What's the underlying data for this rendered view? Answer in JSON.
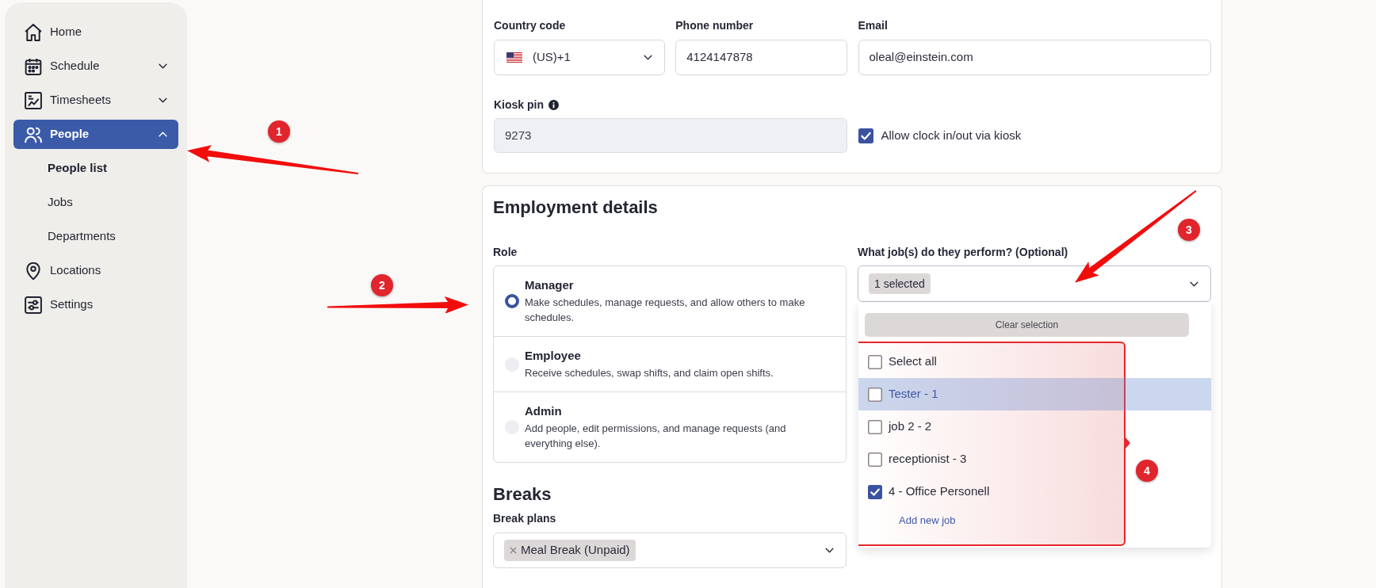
{
  "sidebar": {
    "items": [
      {
        "label": "Home",
        "kind": "link",
        "selected": false
      },
      {
        "label": "Schedule",
        "kind": "group",
        "selected": false,
        "expanded": false
      },
      {
        "label": "Timesheets",
        "kind": "group",
        "selected": false,
        "expanded": false
      },
      {
        "label": "People",
        "kind": "group",
        "selected": true,
        "expanded": true,
        "children": [
          {
            "label": "People list",
            "selected": true
          },
          {
            "label": "Jobs",
            "selected": false
          },
          {
            "label": "Departments",
            "selected": false
          }
        ]
      },
      {
        "label": "Locations",
        "kind": "link",
        "selected": false
      },
      {
        "label": "Settings",
        "kind": "link",
        "selected": false
      }
    ]
  },
  "contact": {
    "country_code": {
      "label": "Country code",
      "value": "(US)+1"
    },
    "phone": {
      "label": "Phone number",
      "value": "4124147878"
    },
    "email": {
      "label": "Email",
      "value": "oleal@einstein.com"
    },
    "kiosk_pin": {
      "label": "Kiosk pin",
      "value": "9273",
      "disabled": true
    },
    "kiosk_clock": {
      "label": "Allow clock in/out via kiosk",
      "checked": true
    }
  },
  "employment": {
    "title": "Employment details",
    "role": {
      "label": "Role",
      "options": [
        {
          "title": "Manager",
          "description": "Make schedules, manage requests, and allow others to make schedules.",
          "selected": true
        },
        {
          "title": "Employee",
          "description": "Receive schedules, swap shifts, and claim open shifts.",
          "selected": false
        },
        {
          "title": "Admin",
          "description": "Add people, edit permissions, and manage requests (and everything else).",
          "selected": false
        }
      ]
    },
    "jobs": {
      "label": "What job(s) do they perform? (Optional)",
      "value": "1 selected",
      "expanded": true,
      "clear_button": "Clear selection",
      "options": [
        {
          "label": "Select all",
          "checked": false,
          "highlighted": false
        },
        {
          "label": "Tester - 1",
          "checked": false,
          "highlighted": true
        },
        {
          "label": "job 2 - 2",
          "checked": false,
          "highlighted": false
        },
        {
          "label": "receptionist - 3",
          "checked": false,
          "highlighted": false
        },
        {
          "label": "4 - Office Personell",
          "checked": true,
          "highlighted": false
        }
      ],
      "add_link": "Add new job"
    }
  },
  "breaks": {
    "title": "Breaks",
    "plans": {
      "label": "Break plans",
      "tags": [
        "Meal Break (Unpaid)"
      ]
    }
  },
  "annotations": [
    {
      "number": "1"
    },
    {
      "number": "2"
    },
    {
      "number": "3"
    },
    {
      "number": "4"
    }
  ]
}
